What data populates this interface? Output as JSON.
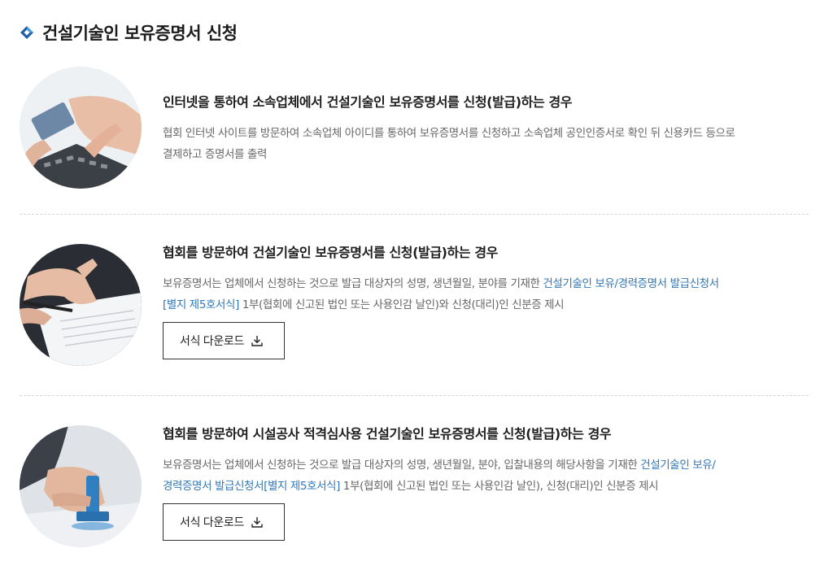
{
  "page": {
    "title": "건설기술인 보유증명서 신청",
    "title_bullet_icon": "blue-diamond-icon",
    "accent_color": "#1f5fa8",
    "link_color": "#2f78b9"
  },
  "sections": [
    {
      "photo_icon": "card-payment-keyboard-photo",
      "title": "인터넷을 통하여 소속업체에서 건설기술인 보유증명서를 신청(발급)하는 경우",
      "line1": "협회 인터넷 사이트를 방문하여 소속업체 아이디를 통하여 보유증명서를 신청하고 소속업체 공인인증서로 확인 뒤 신용카드 등으로",
      "line2": "결제하고 증명서를 출력"
    },
    {
      "photo_icon": "document-signing-photo",
      "title": "협회를 방문하여 건설기술인 보유증명서를 신청(발급)하는 경우",
      "line1_plain": "보유증명서는 업체에서 신청하는 것으로 발급 대상자의 성명, 생년월일, 분야를 기재한 ",
      "line1_link": "건설기술인 보유/경력증명서 발급신청서",
      "line2_link": "[별지 제5호서식]",
      "line2_plain": " 1부(협회에 신고된 법인 또는 사용인감 날인)와 신청(대리)인 신분증 제시",
      "button_label": "서식 다운로드",
      "button_icon": "download-icon"
    },
    {
      "photo_icon": "stamp-seal-photo",
      "title": "협회를 방문하여 시설공사 적격심사용 건설기술인 보유증명서를 신청(발급)하는 경우",
      "line1_plain": "보유증명서는 업체에서 신청하는 것으로 발급 대상자의 성명, 생년월일, 분야, 입찰내용의 해당사항을 기재한 ",
      "line1_link": "건설기술인 보유/",
      "line2_link": "경력증명서 발급신청서[별지 제5호서식]",
      "line2_plain": " 1부(협회에 신고된 법인 또는 사용인감 날인), 신청(대리)인 신분증 제시",
      "button_label": "서식 다운로드",
      "button_icon": "download-icon"
    }
  ]
}
